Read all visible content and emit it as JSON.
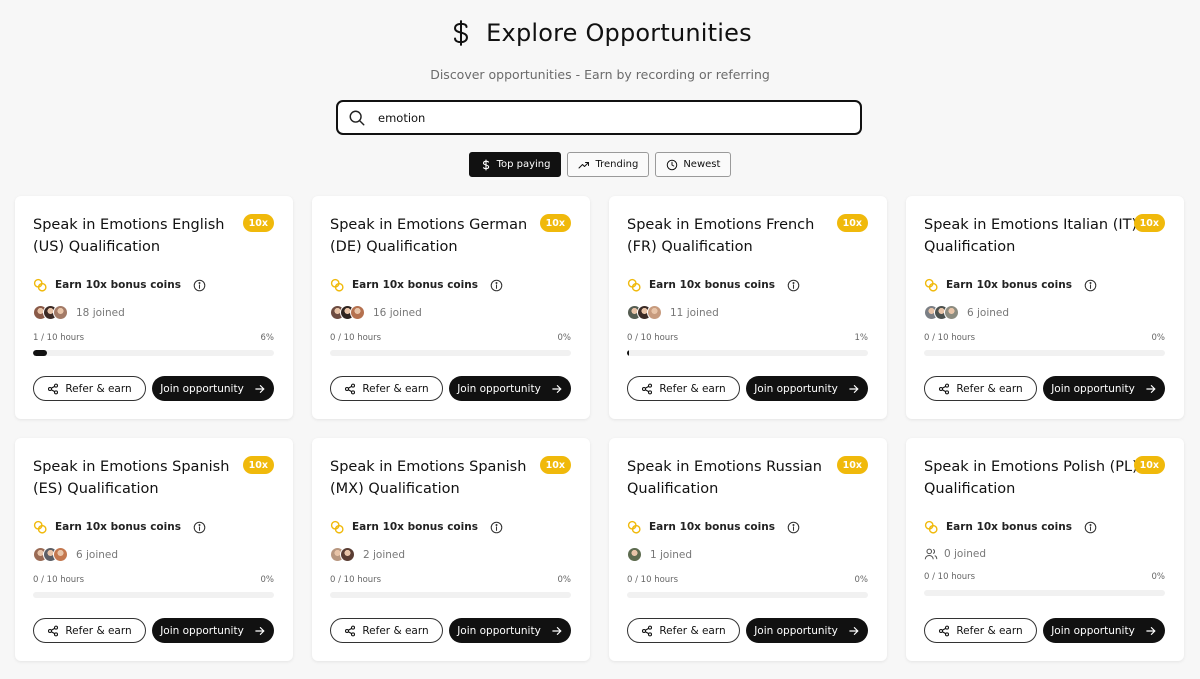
{
  "header": {
    "title": "Explore Opportunities",
    "subtitle": "Discover opportunities - Earn by recording or referring"
  },
  "search": {
    "value": "emotion",
    "placeholder": ""
  },
  "filters": [
    {
      "label": "Top paying",
      "icon": "dollar-icon",
      "active": true
    },
    {
      "label": "Trending",
      "icon": "trending-up-icon",
      "active": false
    },
    {
      "label": "Newest",
      "icon": "clock-icon",
      "active": false
    }
  ],
  "card_common": {
    "badge": "10x",
    "bonus_label": "Earn 10x bonus coins",
    "refer_label": "Refer & earn",
    "join_label": "Join opportunity"
  },
  "colors": {
    "accent": "#f0b90b",
    "dark": "#111111",
    "background": "#f7f7f7"
  },
  "cards": [
    {
      "title": "Speak in Emotions English (US) Qualification",
      "joined": "18 joined",
      "hours": "1 / 10 hours",
      "percent": "6%",
      "progress": 0.06,
      "avatars": [
        "#8a5a48",
        "#3b2a25",
        "#a37a66"
      ]
    },
    {
      "title": "Speak in Emotions German (DE) Qualification",
      "joined": "16 joined",
      "hours": "0 / 10 hours",
      "percent": "0%",
      "progress": 0,
      "avatars": [
        "#6d4c41",
        "#2e2420",
        "#b5714f"
      ]
    },
    {
      "title": "Speak in Emotions French (FR) Qualification",
      "joined": "11 joined",
      "hours": "0 / 10 hours",
      "percent": "1%",
      "progress": 0.01,
      "avatars": [
        "#555d52",
        "#3a2b26",
        "#c79b7e"
      ]
    },
    {
      "title": "Speak in Emotions Italian (IT) Qualification",
      "joined": "6 joined",
      "hours": "0 / 10 hours",
      "percent": "0%",
      "progress": 0,
      "avatars": [
        "#7b7f85",
        "#4c524f",
        "#8c8c80"
      ]
    },
    {
      "title": "Speak in Emotions Spanish (ES) Qualification",
      "joined": "6 joined",
      "hours": "0 / 10 hours",
      "percent": "0%",
      "progress": 0,
      "avatars": [
        "#9a6b55",
        "#5c5f66",
        "#c4784f"
      ]
    },
    {
      "title": "Speak in Emotions Spanish (MX) Qualification",
      "joined": "2 joined",
      "hours": "0 / 10 hours",
      "percent": "0%",
      "progress": 0,
      "avatars": [
        "#b89780",
        "#5a3d33"
      ]
    },
    {
      "title": "Speak in Emotions Russian Qualification",
      "joined": "1 joined",
      "hours": "0 / 10 hours",
      "percent": "0%",
      "progress": 0,
      "avatars": [
        "#5d6b4f"
      ]
    },
    {
      "title": "Speak in Emotions Polish (PL) Qualification",
      "joined": "0 joined",
      "hours": "0 / 10 hours",
      "percent": "0%",
      "progress": 0,
      "avatars": []
    }
  ]
}
